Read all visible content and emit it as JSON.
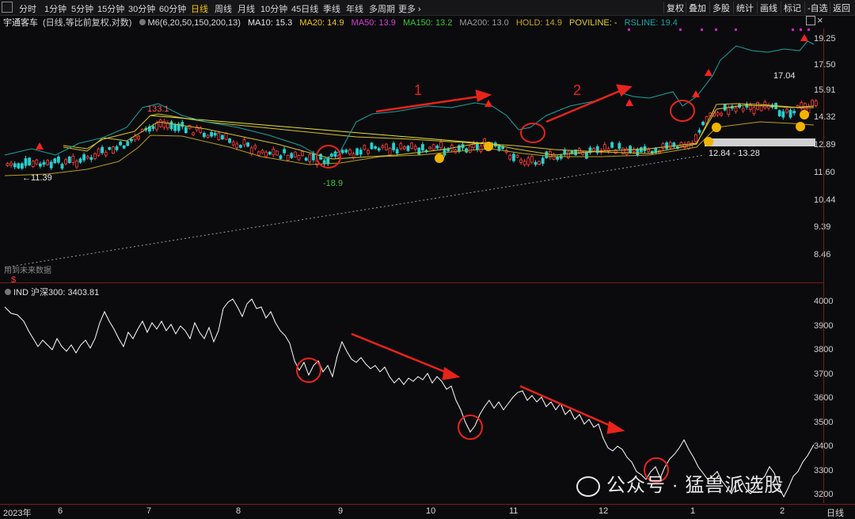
{
  "toolbar": {
    "periods": [
      "分时",
      "1分钟",
      "5分钟",
      "15分钟",
      "30分钟",
      "60分钟",
      "日线",
      "周线",
      "月线",
      "10分钟",
      "45日线",
      "季线",
      "年线",
      "多周期",
      "更多 ›"
    ],
    "active_period": "日线",
    "right_buttons": [
      "复权",
      "叠加",
      "多股",
      "统计",
      "画线",
      "标记",
      "-自选",
      "返回"
    ]
  },
  "info": {
    "stock": "宇通客车",
    "mode": "(日线,等比前复权,对数)",
    "m6": "M6(6,20,50,150,200,13)",
    "ma10": "MA10: 15.3",
    "ma20": "MA20: 14.9",
    "ma50": "MA50: 13.9",
    "ma150": "MA150: 13.2",
    "ma200": "MA200: 13.0",
    "hold": "HOLD: 14.9",
    "poviline": "POVILINE: -",
    "rsline": "RSLINE: 19.4"
  },
  "main_axis": [
    "19.25",
    "17.50",
    "15.91",
    "14.32",
    "12.89",
    "11.60",
    "10.44",
    "9.39",
    "8.46"
  ],
  "main_annotations": {
    "high": "133.1",
    "low_left": "←11.39",
    "low_mid": "-18.9",
    "range": "12.84 - 13.28",
    "recent_high": "17.04",
    "num1": "1",
    "num2": "2",
    "future_note": "用到未来数据",
    "dollar": "$"
  },
  "index": {
    "title": "IND 沪深300: 3403.81",
    "axis": [
      "4000",
      "3900",
      "3800",
      "3700",
      "3600",
      "3500",
      "3400",
      "3300",
      "3200"
    ]
  },
  "months": [
    "2023年",
    "6",
    "7",
    "8",
    "9",
    "10",
    "11",
    "12",
    "1",
    "2"
  ],
  "bottom_right": "日线",
  "watermark": "公众号 · 猛兽派选股",
  "colors": {
    "up": "#ff3b3b",
    "down": "#21d3d3",
    "rsline": "#1aa3a3",
    "accent": "#f0c419",
    "hs300": "#ffffff",
    "annotation": "#e8231c"
  }
}
